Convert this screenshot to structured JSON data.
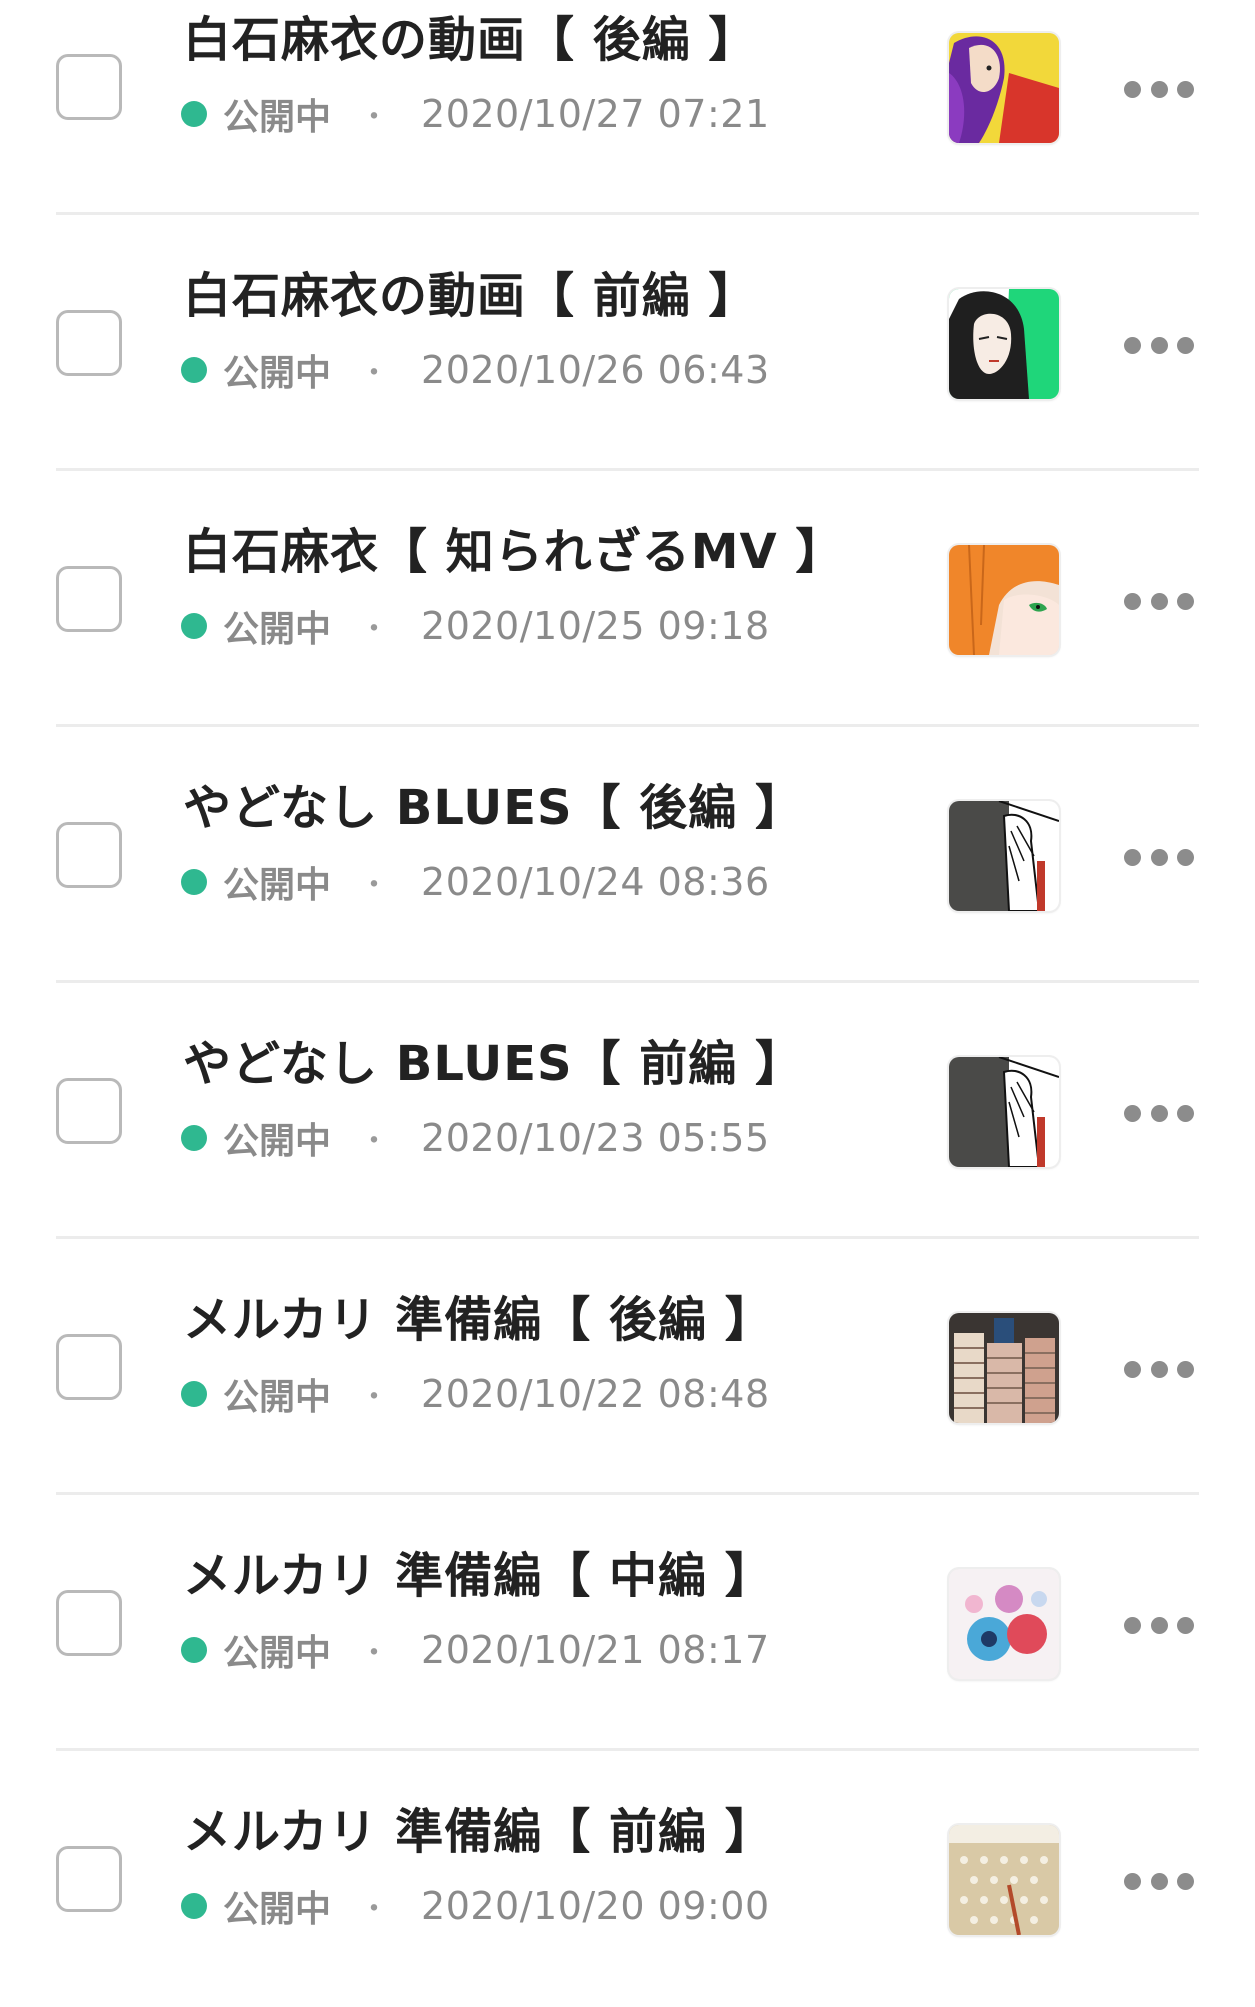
{
  "posts": [
    {
      "title": "白石麻衣の動画【 後編 】",
      "status": "公開中",
      "separator": "・",
      "date": "2020/10/27 07:21",
      "thumb": "thumb-purple-hair-woman-yellow"
    },
    {
      "title": "白石麻衣の動画【 前編 】",
      "status": "公開中",
      "separator": "・",
      "date": "2020/10/26 06:43",
      "thumb": "thumb-woman-green-background"
    },
    {
      "title": "白石麻衣【 知られざるMV 】",
      "status": "公開中",
      "separator": "・",
      "date": "2020/10/25 09:18",
      "thumb": "thumb-orange-hair-green-eye"
    },
    {
      "title": "やどなし BLUES【 後編 】",
      "status": "公開中",
      "separator": "・",
      "date": "2020/10/24 08:36",
      "thumb": "thumb-dark-hand-sketch"
    },
    {
      "title": "やどなし BLUES【 前編 】",
      "status": "公開中",
      "separator": "・",
      "date": "2020/10/23 05:55",
      "thumb": "thumb-dark-hand-sketch"
    },
    {
      "title": "メルカリ 準備編【 後編 】",
      "status": "公開中",
      "separator": "・",
      "date": "2020/10/22 08:48",
      "thumb": "thumb-stacked-books"
    },
    {
      "title": "メルカリ 準備編【 中編 】",
      "status": "公開中",
      "separator": "・",
      "date": "2020/10/21 08:17",
      "thumb": "thumb-beads-colorful"
    },
    {
      "title": "メルカリ 準備編【 前編 】",
      "status": "公開中",
      "separator": "・",
      "date": "2020/10/20 09:00",
      "thumb": "thumb-beige-dotted-package"
    }
  ],
  "colors": {
    "status_dot": "#2fb890",
    "title": "#222222",
    "meta": "#8a8a8a",
    "checkbox_border": "#b9b9b9",
    "divider": "#ececec"
  }
}
